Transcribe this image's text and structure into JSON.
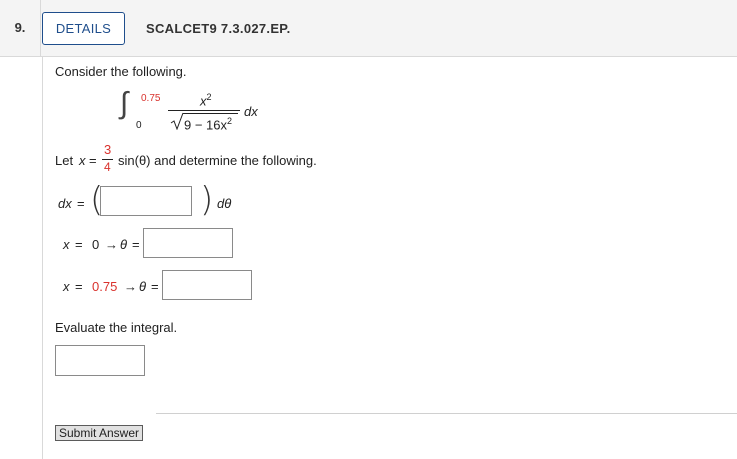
{
  "question": {
    "number": "9.",
    "details_label": "DETAILS",
    "id": "SCALCET9 7.3.027.EP."
  },
  "prompt": "Consider the following.",
  "integral": {
    "upper_limit": "0.75",
    "lower_limit": "0",
    "numerator": "x",
    "numerator_exp": "2",
    "denominator_a": "9 − 16x",
    "denominator_exp": "2",
    "differential": "dx",
    "integral_sign": "∫"
  },
  "substitution": {
    "prefix": "Let",
    "variable": "x",
    "equals": "=",
    "frac_num": "3",
    "frac_den": "4",
    "suffix": "sin(θ) and determine the following."
  },
  "dx_row": {
    "label": "dx",
    "equals": "=",
    "value": "",
    "dtheta": "dθ",
    "open_paren": "(",
    "close_paren": ")"
  },
  "bound1": {
    "x_label": "x",
    "equals": "=",
    "value": "0",
    "arrow": "→",
    "theta": "θ",
    "equals2": "=",
    "answer": ""
  },
  "bound2": {
    "x_label": "x",
    "equals": "=",
    "value": "0.75",
    "arrow": "→",
    "theta": "θ",
    "equals2": "=",
    "answer": ""
  },
  "evaluate_label": "Evaluate the integral.",
  "evaluate_answer": "",
  "submit_label": "Submit Answer",
  "colors": {
    "accent": "#1f4e8c",
    "highlight": "#d9322d"
  }
}
